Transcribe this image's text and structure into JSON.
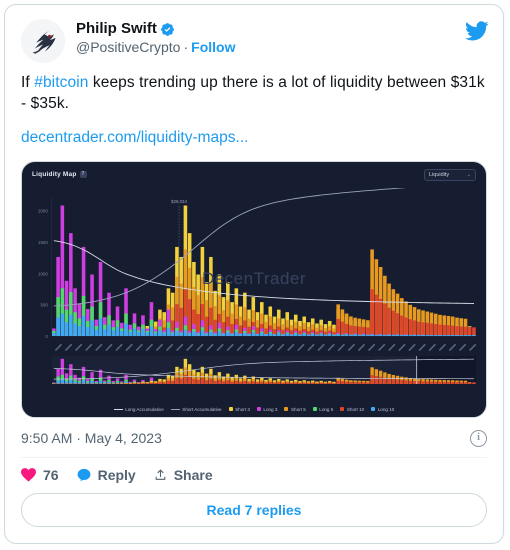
{
  "tweet": {
    "display_name": "Philip Swift",
    "verified_icon": "verified-badge-icon",
    "handle": "@PositiveCrypto",
    "separator": "·",
    "follow_label": "Follow",
    "platform_icon": "twitter-bird-icon",
    "avatar_icon": "swift-bird-avatar",
    "text_part1": "If ",
    "hashtag": "#bitcoin",
    "text_part2": " keeps trending up there is a lot of liquidity between $31k - $35k.",
    "link_text": "decentrader.com/liquidity-maps...",
    "timestamp": "9:50 AM · May 4, 2023",
    "info_icon": "info-circle-icon",
    "likes": "76",
    "reply_label": "Reply",
    "share_label": "Share",
    "read_replies_label": "Read 7 replies",
    "like_icon": "heart-icon",
    "reply_icon": "speech-bubble-icon",
    "share_icon": "share-upload-icon"
  },
  "chart_card": {
    "title": "Liquidity Map",
    "help_icon": "question-mark-icon",
    "help_label": "?",
    "dropdown_value": "Liquidity",
    "dropdown_caret": "chevron-down-icon",
    "caret_glyph": "⌄",
    "camera_icon": "camera-snapshot-icon",
    "watermark": "DecenTrader"
  },
  "chart_data": {
    "type": "bar",
    "title": "Liquidity Map",
    "xlabel": "",
    "ylabel": "",
    "ylim": [
      0,
      2200
    ],
    "yticks": [
      0,
      500,
      1000,
      1500,
      2000
    ],
    "ytick_labels": [
      "0",
      "500",
      "1000",
      "1500",
      "2000"
    ],
    "grid": false,
    "legend_position": "bottom",
    "annotation": {
      "label": "$29,034",
      "x_fraction": 0.3,
      "type": "price-marker"
    },
    "legend": [
      {
        "name": "Long Accumulative",
        "color": "#d8dce8",
        "style": "line"
      },
      {
        "name": "Short Accumulative",
        "color": "#9aa2bd",
        "style": "line"
      },
      {
        "name": "Short 3",
        "color": "#f2d13c",
        "style": "square"
      },
      {
        "name": "Long 3",
        "color": "#cf3ee0",
        "style": "square"
      },
      {
        "name": "Short 5",
        "color": "#e89a1f",
        "style": "square"
      },
      {
        "name": "Long 5",
        "color": "#4fd96a",
        "style": "square"
      },
      {
        "name": "Short 10",
        "color": "#e0452a",
        "style": "square"
      },
      {
        "name": "Long 10",
        "color": "#3fa9f5",
        "style": "square"
      }
    ],
    "series": [
      {
        "name": "Long 3",
        "color": "#cf3ee0",
        "values": [
          120,
          1260,
          2080,
          880,
          1640,
          760,
          520,
          1420,
          430,
          980,
          260,
          1180,
          300,
          690,
          250,
          470,
          210,
          760,
          180,
          360,
          150,
          330,
          120,
          540,
          110,
          260,
          95,
          420,
          90,
          230,
          85,
          310,
          80,
          190,
          70,
          250,
          65,
          170,
          60,
          210,
          55,
          150,
          50,
          180,
          45,
          130,
          42,
          160,
          38,
          120,
          35,
          100,
          32,
          95,
          30,
          85,
          28,
          80,
          26,
          70,
          24,
          65,
          22,
          60,
          20,
          55,
          18,
          50,
          16,
          45,
          15,
          42,
          14,
          38,
          13,
          35,
          12,
          32,
          11,
          30,
          10,
          28,
          10,
          26,
          9,
          24,
          9,
          22,
          8,
          20,
          8,
          19,
          7,
          18,
          7,
          17,
          6,
          16,
          6,
          15
        ]
      },
      {
        "name": "Long 5",
        "color": "#4fd96a",
        "values": [
          80,
          620,
          760,
          420,
          700,
          380,
          280,
          640,
          240,
          470,
          160,
          540,
          180,
          330,
          140,
          250,
          120,
          360,
          100,
          200,
          90,
          180,
          80,
          260,
          70,
          150,
          60,
          220,
          58,
          130,
          55,
          170,
          50,
          110,
          46,
          140,
          44,
          100,
          40,
          120,
          38,
          90,
          36,
          105,
          34,
          80,
          32,
          95,
          30,
          72,
          28,
          64,
          27,
          58,
          26,
          54,
          25,
          50,
          24,
          46,
          23,
          42,
          22,
          40,
          21,
          36,
          20,
          34,
          19,
          30,
          18,
          28,
          17,
          26,
          16,
          24,
          15,
          22,
          14,
          21,
          14,
          20,
          13,
          19,
          13,
          18,
          12,
          17,
          12,
          16,
          11,
          15,
          11,
          14,
          10,
          14,
          10,
          13,
          10,
          12
        ]
      },
      {
        "name": "Long 10",
        "color": "#3fa9f5",
        "values": [
          50,
          300,
          360,
          220,
          340,
          200,
          160,
          320,
          140,
          250,
          100,
          280,
          110,
          180,
          90,
          140,
          80,
          200,
          70,
          120,
          64,
          108,
          58,
          150,
          52,
          94,
          48,
          128,
          46,
          84,
          44,
          100,
          42,
          72,
          40,
          88,
          38,
          66,
          36,
          76,
          34,
          60,
          33,
          68,
          32,
          54,
          31,
          62,
          30,
          50,
          29,
          46,
          28,
          42,
          27,
          40,
          26,
          38,
          25,
          36,
          24,
          34,
          24,
          32,
          23,
          30,
          22,
          28,
          22,
          26,
          21,
          25,
          20,
          24,
          20,
          23,
          19,
          22,
          19,
          21,
          18,
          20,
          18,
          19,
          17,
          18,
          17,
          18,
          16,
          17,
          16,
          16,
          15,
          16,
          15,
          15,
          14,
          15,
          14,
          14
        ]
      },
      {
        "name": "Short 3",
        "color": "#f2d13c",
        "values": [
          10,
          14,
          12,
          18,
          16,
          22,
          20,
          28,
          26,
          34,
          30,
          42,
          38,
          55,
          48,
          72,
          60,
          95,
          78,
          130,
          110,
          185,
          160,
          260,
          230,
          420,
          380,
          760,
          690,
          1420,
          1260,
          2080,
          1640,
          1180,
          980,
          1420,
          860,
          1260,
          720,
          980,
          620,
          860,
          540,
          760,
          470,
          690,
          420,
          620,
          380,
          540,
          340,
          470,
          310,
          420,
          280,
          380,
          260,
          340,
          240,
          310,
          220,
          280,
          200,
          260,
          190,
          240,
          180,
          420,
          360,
          300,
          260,
          240,
          220,
          200,
          190,
          760,
          690,
          620,
          540,
          470,
          420,
          380,
          340,
          310,
          280,
          260,
          240,
          230,
          220,
          210,
          200,
          190,
          185,
          180,
          175,
          170,
          165,
          160,
          155
        ]
      },
      {
        "name": "Short 5",
        "color": "#e89a1f",
        "values": [
          6,
          9,
          8,
          12,
          11,
          15,
          14,
          19,
          18,
          23,
          21,
          28,
          26,
          37,
          33,
          48,
          41,
          63,
          52,
          86,
          74,
          122,
          106,
          172,
          152,
          278,
          252,
          504,
          458,
          942,
          836,
          1380,
          1088,
          782,
          650,
          942,
          570,
          836,
          478,
          650,
          411,
          570,
          358,
          504,
          312,
          458,
          278,
          411,
          252,
          358,
          225,
          312,
          206,
          278,
          186,
          252,
          172,
          225,
          159,
          206,
          146,
          186,
          133,
          172,
          126,
          159,
          119,
          504,
          424,
          358,
          312,
          292,
          278,
          265,
          252,
          1380,
          1224,
          1100,
          960,
          836,
          746,
          675,
          604,
          550,
          497,
          461,
          425,
          408,
          390,
          373,
          355,
          337,
          328,
          319,
          310,
          293,
          284,
          275
        ]
      },
      {
        "name": "Short 10",
        "color": "#e0452a",
        "values": [
          3,
          5,
          4,
          6,
          6,
          8,
          7,
          10,
          9,
          12,
          11,
          15,
          14,
          20,
          18,
          26,
          22,
          34,
          28,
          46,
          40,
          66,
          57,
          93,
          82,
          150,
          136,
          272,
          247,
          508,
          451,
          745,
          587,
          422,
          351,
          508,
          308,
          451,
          258,
          351,
          222,
          308,
          193,
          272,
          168,
          247,
          150,
          222,
          136,
          193,
          121,
          168,
          111,
          150,
          100,
          136,
          93,
          121,
          86,
          111,
          79,
          100,
          72,
          93,
          68,
          86,
          64,
          272,
          229,
          193,
          168,
          158,
          150,
          143,
          136,
          745,
          661,
          594,
          518,
          451,
          403,
          364,
          326,
          297,
          268,
          249,
          229,
          220,
          211,
          201,
          192,
          182,
          177,
          172,
          167,
          158,
          153,
          148,
          143,
          138
        ]
      },
      {
        "name": "Long Accumulative",
        "color": "#d8dce8",
        "style": "line",
        "values": [
          1520,
          1510,
          1495,
          1480,
          1460,
          1435,
          1405,
          1375,
          1340,
          1300,
          1258,
          1215,
          1170,
          1128,
          1088,
          1050,
          1018,
          990,
          965,
          942,
          920,
          900,
          882,
          864,
          848,
          833,
          818,
          805,
          792,
          780,
          768,
          757,
          746,
          736,
          726,
          717,
          708,
          700,
          692,
          684,
          677,
          670,
          663,
          657,
          651,
          645,
          640,
          634,
          629,
          624,
          620,
          615,
          611,
          607,
          603,
          599,
          596,
          592,
          589,
          586,
          583,
          580,
          577,
          574,
          572,
          569,
          567,
          565,
          562,
          560,
          558,
          556,
          554,
          552,
          550,
          548,
          547,
          545,
          543,
          542,
          540,
          539,
          537,
          536,
          535,
          533,
          532,
          531,
          530,
          528,
          527,
          526,
          525,
          524,
          523,
          522,
          521,
          520,
          519,
          518
        ]
      },
      {
        "name": "Short Accumulative",
        "color": "#9aa2bd",
        "style": "line",
        "values": [
          480,
          483,
          487,
          492,
          498,
          505,
          513,
          522,
          532,
          543,
          556,
          570,
          586,
          603,
          622,
          643,
          666,
          691,
          718,
          748,
          780,
          815,
          852,
          892,
          934,
          978,
          1024,
          1072,
          1122,
          1174,
          1228,
          1283,
          1339,
          1396,
          1453,
          1510,
          1566,
          1621,
          1674,
          1725,
          1773,
          1818,
          1860,
          1899,
          1935,
          1968,
          1998,
          2025,
          2050,
          2072,
          2092,
          2110,
          2127,
          2142,
          2156,
          2169,
          2181,
          2192,
          2202,
          2212,
          2221,
          2230,
          2238,
          2246,
          2254,
          2261,
          2268,
          2275,
          2282,
          2288,
          2294,
          2300,
          2306,
          2312,
          2318,
          2323,
          2329,
          2334,
          2340,
          2345,
          2350,
          2356,
          2361,
          2366,
          2371,
          2376,
          2381,
          2386,
          2391,
          2396,
          2401,
          2406,
          2411,
          2415,
          2420,
          2425,
          2429,
          2434,
          2438,
          2443
        ]
      }
    ],
    "overview_panel": {
      "present": true,
      "description": "range-selector-minimap",
      "selected_fraction": [
        0.0,
        0.86
      ]
    },
    "xtick_labels_rotated": true
  }
}
